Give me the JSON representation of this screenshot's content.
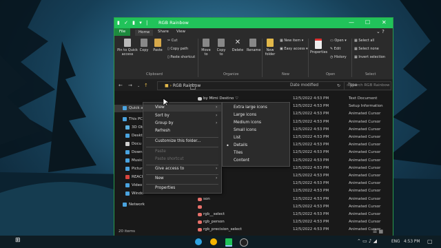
{
  "window": {
    "title": "RGB Rainbow",
    "controls": [
      "—",
      "☐",
      "✕"
    ]
  },
  "ribbon_tabs": [
    "File",
    "Home",
    "Share",
    "View"
  ],
  "ribbon": {
    "clipboard": {
      "pin": "Pin to Quick access",
      "copy": "Copy",
      "paste": "Paste",
      "cut": "Cut",
      "copy_path": "Copy path",
      "paste_shortcut": "Paste shortcut",
      "label": "Clipboard"
    },
    "organize": {
      "move_to": "Move to",
      "copy_to": "Copy to",
      "delete": "Delete",
      "rename": "Rename",
      "label": "Organize"
    },
    "new": {
      "new_folder": "New folder",
      "new_item": "New item ▾",
      "easy_access": "Easy access ▾",
      "label": "New"
    },
    "open": {
      "properties": "Properties",
      "open": "Open ▾",
      "edit": "Edit",
      "history": "History",
      "label": "Open"
    },
    "select": {
      "select_all": "Select all",
      "select_none": "Select none",
      "invert": "Invert selection",
      "label": "Select"
    }
  },
  "address": {
    "path": "RGB Rainbow",
    "search_placeholder": "Search RGB Rainbow"
  },
  "nav_pane": {
    "items": [
      {
        "label": "Quick access",
        "color": "#4aa3df"
      },
      {
        "label": "This PC",
        "color": "#4aa3df"
      },
      {
        "label": "3D Ob",
        "color": "#5bb0e0"
      },
      {
        "label": "Deskt",
        "color": "#4aa3df"
      },
      {
        "label": "Docu",
        "color": "#cfcfcf"
      },
      {
        "label": "Down",
        "color": "#4aa3df"
      },
      {
        "label": "Music",
        "color": "#4aa3df"
      },
      {
        "label": "Pictur",
        "color": "#4aa3df"
      },
      {
        "label": "REACH",
        "color": "#d9453d"
      },
      {
        "label": "Video",
        "color": "#4aa3df"
      },
      {
        "label": "Windo",
        "color": "#4aa3df"
      },
      {
        "label": "Network",
        "color": "#4aa3df"
      }
    ]
  },
  "columns": {
    "date": "Date modified",
    "type": "Type"
  },
  "files": [
    {
      "name": "by Mimi Destino ♡",
      "date": "12/5/2022 4:53 PM",
      "type": "Text Document",
      "color": "#cfcfcf"
    },
    {
      "name": "",
      "date": "12/5/2022 4:53 PM",
      "type": "Setup Information",
      "color": "#cfcfcf"
    },
    {
      "name": "",
      "date": "12/5/2022 4:53 PM",
      "type": "Animated Cursor",
      "color": "#e8706a"
    },
    {
      "name": "",
      "date": "12/5/2022 4:53 PM",
      "type": "Animated Cursor",
      "color": "#e8706a"
    },
    {
      "name": "",
      "date": "12/5/2022 4:53 PM",
      "type": "Animated Cursor",
      "color": "#e8706a"
    },
    {
      "name": "",
      "date": "12/5/2022 4:53 PM",
      "type": "Animated Cursor",
      "color": "#e8706a"
    },
    {
      "name": "",
      "date": "12/5/2022 4:53 PM",
      "type": "Animated Cursor",
      "color": "#e8706a"
    },
    {
      "name": "",
      "date": "12/5/2022 4:53 PM",
      "type": "Animated Cursor",
      "color": "#e8706a"
    },
    {
      "name": "",
      "date": "12/5/2022 4:53 PM",
      "type": "Animated Cursor",
      "color": "#e8706a"
    },
    {
      "name": "",
      "date": "12/5/2022 4:53 PM",
      "type": "Animated Cursor",
      "color": "#e8706a"
    },
    {
      "name": "",
      "date": "12/5/2022 4:53 PM",
      "type": "Animated Cursor",
      "color": "#e8706a"
    },
    {
      "name": "",
      "date": "12/5/2022 4:53 PM",
      "type": "Animated Cursor",
      "color": "#e8706a"
    },
    {
      "name": "_select",
      "date": "12/5/2022 4:53 PM",
      "type": "Animated Cursor",
      "color": "#e8706a"
    },
    {
      "name": "son",
      "date": "12/5/2022 4:53 PM",
      "type": "Animated Cursor",
      "color": "#e8706a"
    },
    {
      "name": "",
      "date": "12/5/2022 4:53 PM",
      "type": "Animated Cursor",
      "color": "#e8706a"
    },
    {
      "name": "rgb__select",
      "date": "12/5/2022 4:53 PM",
      "type": "Animated Cursor",
      "color": "#e8706a"
    },
    {
      "name": "rgb_person",
      "date": "12/5/2022 4:53 PM",
      "type": "Animated Cursor",
      "color": "#e8706a"
    },
    {
      "name": "rgb_precision_select",
      "date": "12/5/2022 4:53 PM",
      "type": "Animated Cursor",
      "color": "#e8706a"
    },
    {
      "name": "rgb_text_select",
      "date": "12/5/2022 4:53 PM",
      "type": "Animated Cursor",
      "color": "#e8706a"
    }
  ],
  "status": {
    "count": "20 items"
  },
  "context_menu": {
    "items": [
      {
        "label": "View",
        "submenu": true,
        "disabled": false,
        "highlight": true
      },
      {
        "label": "Sort by",
        "submenu": true,
        "disabled": false
      },
      {
        "label": "Group by",
        "submenu": true,
        "disabled": false
      },
      {
        "label": "Refresh",
        "submenu": false,
        "disabled": false
      },
      {
        "label": "Customize this folder...",
        "submenu": false,
        "disabled": false
      },
      {
        "label": "Paste",
        "submenu": false,
        "disabled": true
      },
      {
        "label": "Paste shortcut",
        "submenu": false,
        "disabled": true
      },
      {
        "label": "Give access to",
        "submenu": true,
        "disabled": false
      },
      {
        "label": "New",
        "submenu": true,
        "disabled": false
      },
      {
        "label": "Properties",
        "submenu": false,
        "disabled": false
      }
    ]
  },
  "view_submenu": {
    "items": [
      {
        "label": "Extra large icons",
        "checked": false
      },
      {
        "label": "Large icons",
        "checked": false
      },
      {
        "label": "Medium icons",
        "checked": false
      },
      {
        "label": "Small icons",
        "checked": false
      },
      {
        "label": "List",
        "checked": false
      },
      {
        "label": "Details",
        "checked": true
      },
      {
        "label": "Tiles",
        "checked": false
      },
      {
        "label": "Content",
        "checked": false
      }
    ]
  },
  "taskbar": {
    "lang": "ENG",
    "time": "4:53 PM"
  }
}
